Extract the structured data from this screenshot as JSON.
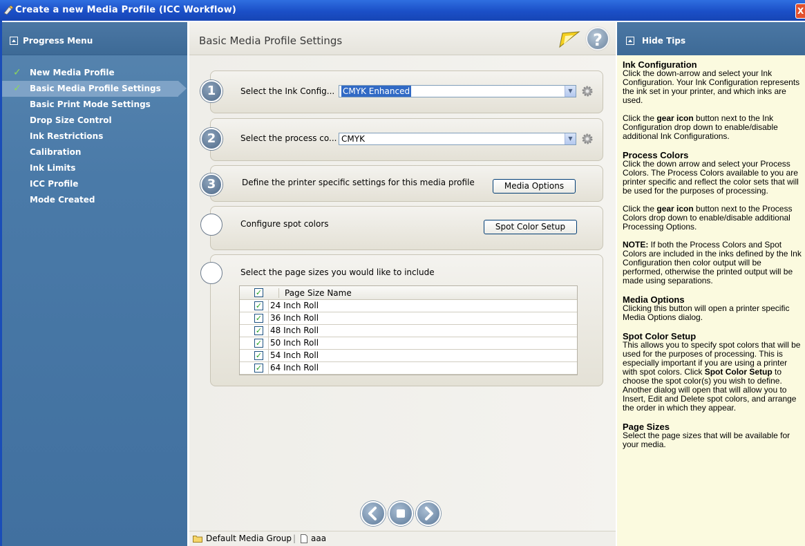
{
  "window": {
    "title": "Create a new Media Profile (ICC Workflow)",
    "close_glyph": "X"
  },
  "sidebar": {
    "header": "Progress Menu",
    "items": [
      {
        "label": "New Media Profile",
        "done": true
      },
      {
        "label": "Basic Media Profile Settings",
        "done": true,
        "active": true
      },
      {
        "label": "Basic Print Mode Settings"
      },
      {
        "label": "Drop Size Control"
      },
      {
        "label": "Ink Restrictions"
      },
      {
        "label": "Calibration"
      },
      {
        "label": "Ink Limits"
      },
      {
        "label": "ICC Profile"
      },
      {
        "label": "Mode Created"
      }
    ]
  },
  "main": {
    "title": "Basic Media Profile Settings",
    "steps": {
      "ink": {
        "number": "1",
        "label": "Select the Ink Config...",
        "value": "CMYK Enhanced"
      },
      "process": {
        "number": "2",
        "label": "Select the process co...",
        "value": "CMYK"
      },
      "printer": {
        "number": "3",
        "label": "Define the printer specific settings for this media profile",
        "button": "Media Options"
      },
      "spot": {
        "label": "Configure spot colors",
        "button": "Spot Color Setup"
      },
      "pages": {
        "label": "Select the page sizes you would like to include",
        "column": "Page Size Name",
        "rows": [
          "24 Inch Roll",
          "36 Inch Roll",
          "48 Inch Roll",
          "50 Inch Roll",
          "54 Inch Roll",
          "64 Inch Roll"
        ]
      }
    },
    "status": {
      "group": "Default Media Group",
      "profile": "aaa"
    }
  },
  "tips": {
    "header": "Hide Tips",
    "ink_title": "Ink Configuration",
    "ink_text": "Click the down-arrow and select your Ink Configuration. Your Ink Configuration represents the ink set in your printer, and which inks are used.",
    "ink_gear_a": "Click the ",
    "ink_gear_b": "gear icon",
    "ink_gear_c": " button next to the Ink Configuration drop down to enable/disable additional Ink Configurations.",
    "proc_title": "Process Colors",
    "proc_text": "Click the down arrow and select your Process Colors. The Process Colors available to you are printer specific and reflect the color sets that will be used for the purposes of processing.",
    "proc_gear_a": "Click the ",
    "proc_gear_b": "gear icon",
    "proc_gear_c": " button next to the Process Colors drop down to enable/disable additional Processing Options.",
    "note_a": "NOTE:",
    "note_b": " If both the Process Colors and Spot Colors are included in the inks defined by the Ink Configuration then color output will be performed, otherwise the printed output will be made using separations.",
    "media_title": "Media Options",
    "media_text": "Clicking this button will open a printer specific Media Options dialog.",
    "spot_title": "Spot Color Setup",
    "spot_a": "This allows you to specify spot colors that will be used for the purposes of processing. This is especially important if you are using a printer with spot colors. Click ",
    "spot_b": "Spot Color Setup",
    "spot_c": " to choose the spot color(s) you wish to define. Another dialog will open that will allow you to Insert, Edit and Delete spot colors, and arrange the order in which they appear.",
    "page_title": "Page Sizes",
    "page_text": "Select the page sizes that will be available for your media."
  }
}
